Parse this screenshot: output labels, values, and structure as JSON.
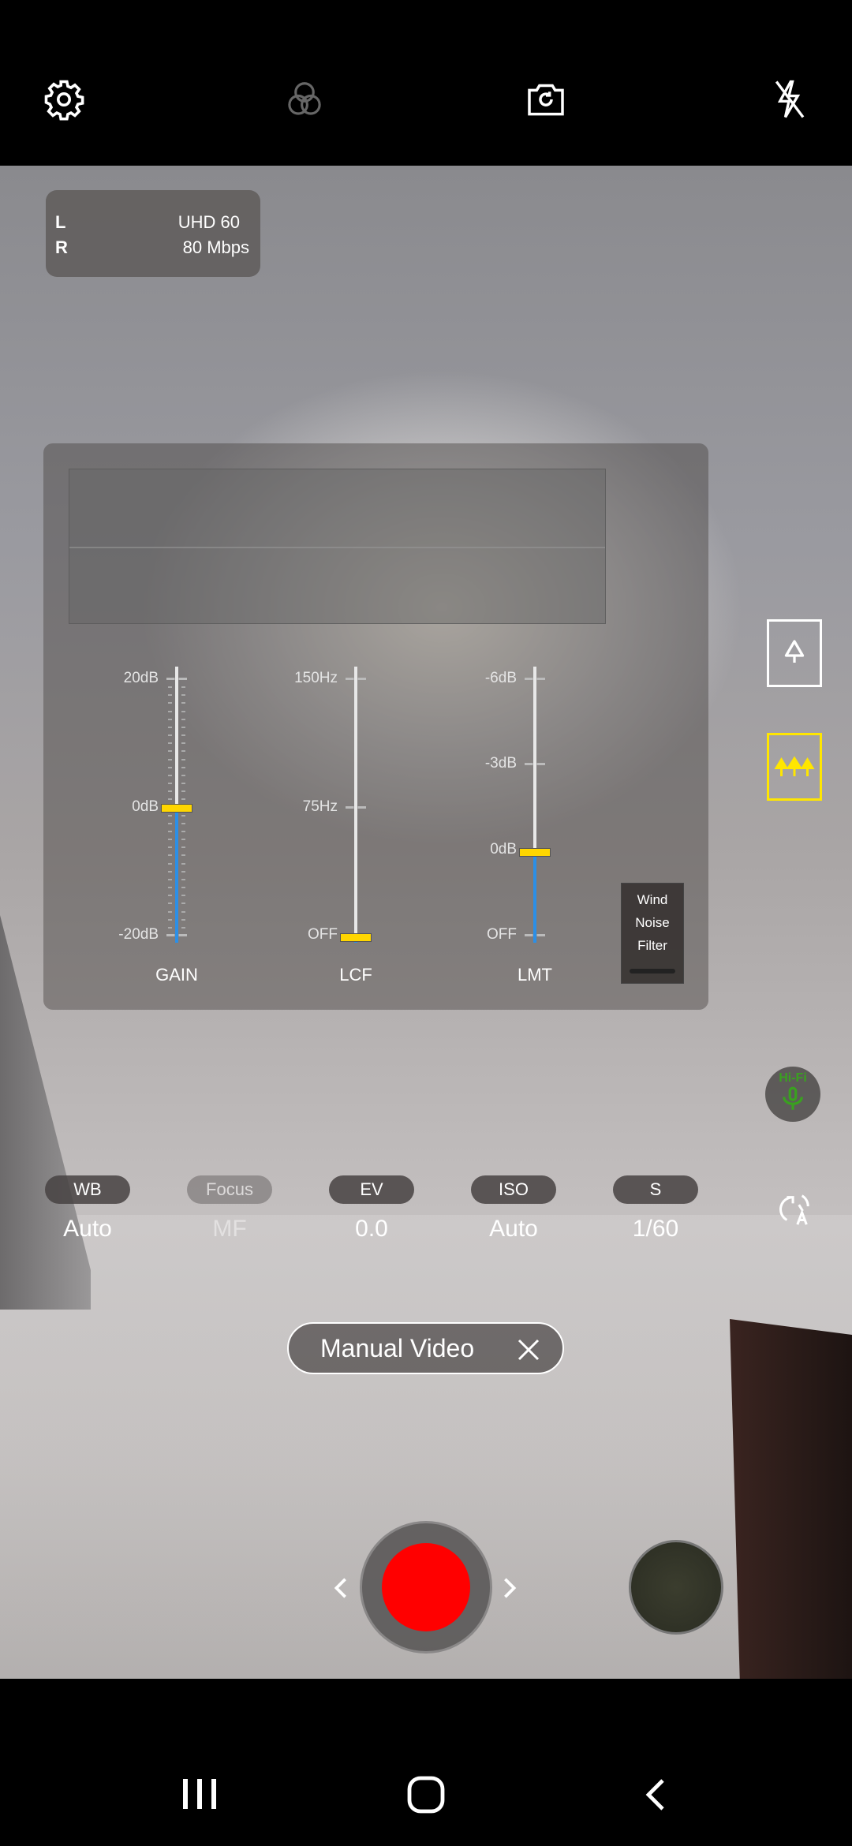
{
  "top_bar": {
    "icons": [
      "settings-icon",
      "color-filter-icon",
      "switch-camera-icon",
      "flash-off-icon"
    ]
  },
  "info": {
    "left_label": "L",
    "right_label": "R",
    "resolution": "UHD 60",
    "bitrate": "80 Mbps"
  },
  "audio": {
    "sliders": [
      {
        "label": "GAIN",
        "ticks": [
          "20dB",
          "0dB",
          "-20dB"
        ],
        "value": "0dB",
        "level": 0.5
      },
      {
        "label": "LCF",
        "ticks": [
          "150Hz",
          "75Hz",
          "OFF"
        ],
        "value": "OFF",
        "level": 0.0
      },
      {
        "label": "LMT",
        "ticks": [
          "-6dB",
          "-3dB",
          "0dB",
          "OFF"
        ],
        "value": "0dB",
        "level": 0.33
      }
    ],
    "wind_filter": {
      "line1": "Wind",
      "line2": "Noise",
      "line3": "Filter"
    }
  },
  "side": {
    "mic_mode_single": "tree-icon",
    "mic_mode_wide": "trees-icon",
    "hifi_label": "Hi-Fi",
    "accent": "#ffe600",
    "hifi_color": "#3aa020"
  },
  "settings": [
    {
      "label": "WB",
      "value": "Auto",
      "enabled": true
    },
    {
      "label": "Focus",
      "value": "MF",
      "enabled": false
    },
    {
      "label": "EV",
      "value": "0.0",
      "enabled": true
    },
    {
      "label": "ISO",
      "value": "Auto",
      "enabled": true
    },
    {
      "label": "S",
      "value": "1/60",
      "enabled": true
    }
  ],
  "mode": {
    "label": "Manual Video"
  },
  "record": {
    "color": "#ff0000"
  }
}
